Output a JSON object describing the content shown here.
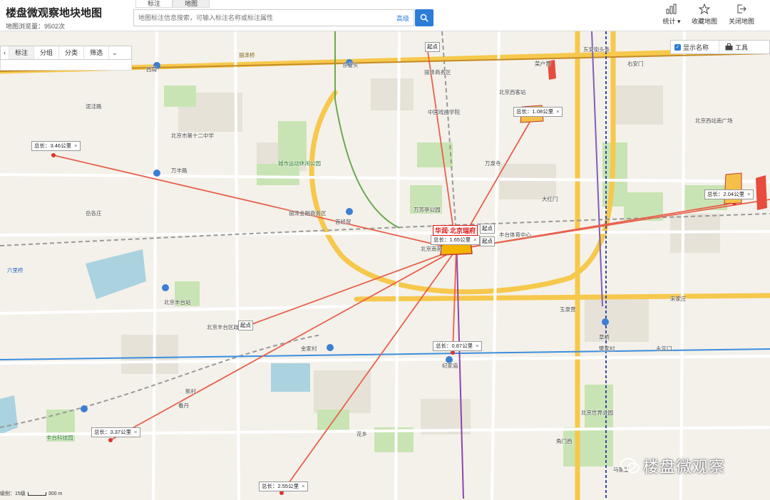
{
  "header": {
    "title": "楼盘微观察地块地图",
    "views": "地图浏览量：9502次",
    "tabs": [
      "标注",
      "地图"
    ],
    "search_placeholder": "地图标注信息搜索，可输入标注名称或标注属性",
    "advanced": "高级",
    "tools": [
      {
        "label": "统计",
        "icon": "bar-chart-icon"
      },
      {
        "label": "收藏地图",
        "icon": "star-icon"
      },
      {
        "label": "关闭地图",
        "icon": "exit-icon"
      }
    ]
  },
  "toolbar": {
    "items": [
      "标注",
      "分组",
      "分类",
      "筛选"
    ]
  },
  "right_tools": {
    "show_names": "显示名称",
    "tools": "工具"
  },
  "project_label": "华润·北京瑞府",
  "distances": [
    {
      "text": "总长：3.46公里"
    },
    {
      "text": "总长：1.08公里"
    },
    {
      "text": "总长：2.04公里"
    },
    {
      "text": "总长：1.65公里"
    },
    {
      "text": "总长：0.87公里"
    },
    {
      "text": "总长：3.37公里"
    },
    {
      "text": "总长：2.55公里"
    }
  ],
  "start_labels": [
    "起点",
    "起点",
    "起点",
    "起点"
  ],
  "map_labels": [
    "北京丰台站",
    "东管头",
    "丽泽桥",
    "丽泽商务区",
    "万泉寺",
    "北京西客站",
    "大红门",
    "菜户营",
    "西局",
    "丰台体育中心",
    "北京南苑",
    "宋家庄",
    "万丰路",
    "北京丰台区政府",
    "金家村",
    "首经贸",
    "纪家庙",
    "草桥",
    "角门西",
    "马家堡",
    "丽泽金融商务区",
    "万芳亭公园",
    "右安门",
    "丰台科技园",
    "北京世界公园",
    "樊家村",
    "东安街头条",
    "新村",
    "花乡",
    "看丹",
    "六里桥",
    "岳各庄",
    "城市运动休闲公园",
    "中国戏曲学院",
    "北京市第十二中学",
    "泥洼路",
    "永定门",
    "玉泉营",
    "北京西站南广场"
  ],
  "scale": {
    "zoom": "级别：15级",
    "bar": "300 m"
  },
  "watermark": "楼盘微观察"
}
